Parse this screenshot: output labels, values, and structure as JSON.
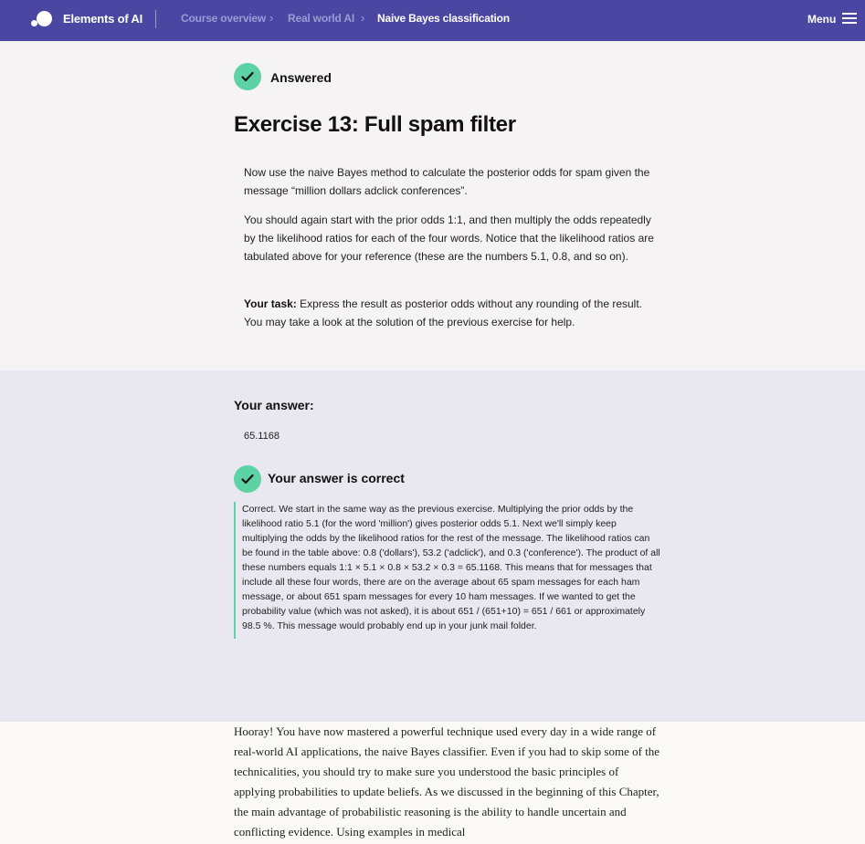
{
  "nav": {
    "brand": "Elements of AI",
    "breadcrumbs": [
      "Course overview",
      "Real world AI",
      "Naive Bayes classification"
    ],
    "menu_label": "Menu"
  },
  "exercise": {
    "status": "Answered",
    "title": "Exercise 13: Full spam filter",
    "paragraph1": "Now use the naive Bayes method to calculate the posterior odds for spam given the message “million dollars adclick conferences”.",
    "paragraph2": "You should again start with the prior odds 1:1, and then multiply the odds repeatedly by the likelihood ratios for each of the four words. Notice that the likelihood ratios are tabulated above for your reference (these are the numbers 5.1, 0.8, and so on).",
    "task_label": "Your task:",
    "task_text": " Express the result as posterior odds without any rounding of the result. You may take a look at the solution of the previous exercise for help."
  },
  "answer": {
    "label": "Your answer:",
    "value": "65.1168",
    "result_label": "Your answer is correct",
    "feedback": "Correct. We start in the same way as the previous exercise. Multiplying the prior odds by the likelihood ratio 5.1 (for the word 'million') gives posterior odds 5.1. Next we'll simply keep multiplying the odds by the likelihood ratios for the rest of the message. The likelihood ratios can be found in the table above: 0.8 ('dollars'), 53.2 ('adclick'), and 0.3 ('conference'). The product of all these numbers equals 1:1 × 5.1 × 0.8 × 53.2 × 0.3 = 65.1168. This means that for messages that include all these four words, there are on the average about 65 spam messages for each ham message, or about 651 spam messages for every 10 ham messages. If we wanted to get the probability value (which was not asked), it is about 651 / (651+10) = 651 / 661 or approximately 98.5 %. This message would probably end up in your junk mail folder."
  },
  "closing": {
    "text": "Hooray! You have now mastered a powerful technique used every day in a wide range of real-world AI applications, the naive Bayes classifier. Even if you had to skip some of the technicalities, you should try to make sure you understood the basic principles of applying probabilities to update beliefs. As we discussed in the beginning of this Chapter, the main advantage of probabilistic reasoning is the ability to handle uncertain and conflicting evidence. Using examples in medical"
  },
  "colors": {
    "nav_bg": "#4a47a3",
    "accent_green": "#5dd3a5",
    "answer_bg": "#e9e7ef"
  }
}
